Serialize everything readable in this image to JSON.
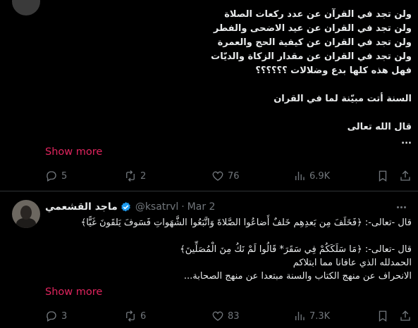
{
  "post1": {
    "body": "ولن تجد في القرآن عن عدد ركعات الصلاة\nولن تجد في القران عن عيد الاضحى والفطر\nولن تجد في القران عن كيفية الحج والعمرة\nولن تجد في القران عن مقدار الزكاة والديّات\nفهل هذه كلها بدع وضلالات ؟؟؟؟؟؟\n\nالسنة أتت مبيّنة لما في القران\n\nقال الله تعالى\n...",
    "show_more": "Show more",
    "stats": {
      "replies": "5",
      "reposts": "2",
      "likes": "76",
      "views": "6.9K"
    }
  },
  "post2": {
    "display_name": "ماجد القشعمي",
    "handle": "@ksatrvl",
    "separator": "·",
    "date": "Mar 2",
    "body": "قال -تعالى-: ﴿فَخَلَفَ مِن بَعدِهِم خَلفٌ أَضاعُوا الصَّلاةَ وَاتَّبَعُوا الشَّهَواتِ فَسَوفَ يَلقَونَ غَيًّا﴾\n\nقال -تعالى-: ﴿مَا سَلَكَكُمْ فِي سَقَرَ* قَالُوا لَمْ نَكُ مِنَ الْمُصَلِّينَ﴾\nالحمدلله الذي عافانا مما ابتلاكم\nالانحراف عن منهج الكتاب والسنة مبتعدا  عن منهج الصحابة...",
    "show_more": "Show more",
    "stats": {
      "replies": "3",
      "reposts": "6",
      "likes": "83",
      "views": "7.3K"
    }
  },
  "colors": {
    "accent": "#e0245e",
    "verified": "#1d9bf0",
    "muted": "#71767b",
    "text": "#e7e9ea",
    "background": "#000000"
  }
}
